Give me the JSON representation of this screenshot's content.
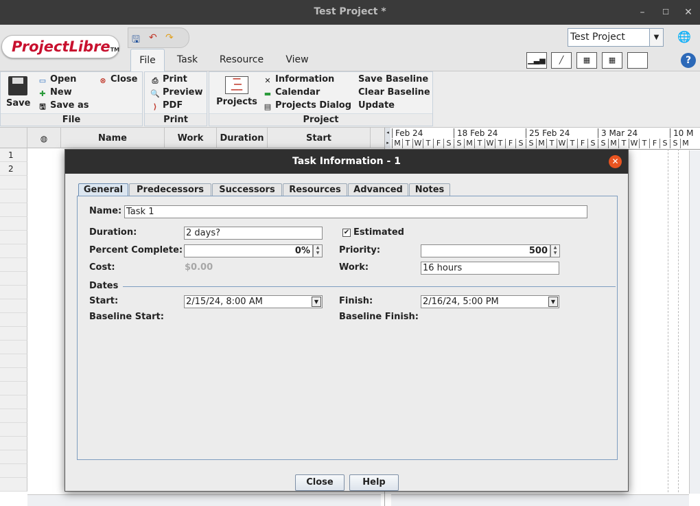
{
  "window": {
    "title": "Test Project *"
  },
  "logo": {
    "part1": "Project",
    "part2": "Libre",
    "tm": "TM"
  },
  "menu_tabs": [
    "File",
    "Task",
    "Resource",
    "View"
  ],
  "project_selector": {
    "value": "Test Project"
  },
  "ribbon": {
    "file_group": {
      "title": "File",
      "save": "Save",
      "open": "Open",
      "new": "New",
      "save_as": "Save as",
      "close": "Close"
    },
    "print_group": {
      "title": "Print",
      "print": "Print",
      "preview": "Preview",
      "pdf": "PDF"
    },
    "project_group": {
      "title": "Project",
      "projects": "Projects",
      "information": "Information",
      "calendar": "Calendar",
      "projects_dialog": "Projects Dialog",
      "save_baseline": "Save Baseline",
      "clear_baseline": "Clear Baseline",
      "update": "Update"
    }
  },
  "table": {
    "columns": [
      "Name",
      "Work",
      "Duration",
      "Start"
    ],
    "rows": [
      "1",
      "2"
    ]
  },
  "gantt": {
    "weeks": [
      "Feb 24",
      "18 Feb 24",
      "25 Feb 24",
      "3 Mar 24",
      "10 M"
    ],
    "days": [
      "M",
      "T",
      "W",
      "T",
      "F",
      "S",
      "S",
      "M",
      "T",
      "W",
      "T",
      "F",
      "S",
      "S",
      "M",
      "T",
      "W",
      "T",
      "F",
      "S",
      "S",
      "M",
      "T",
      "W",
      "T",
      "F",
      "S",
      "S",
      "M"
    ]
  },
  "dialog": {
    "title": "Task Information - 1",
    "tabs": [
      "General",
      "Predecessors",
      "Successors",
      "Resources",
      "Advanced",
      "Notes"
    ],
    "name_label": "Name:",
    "name_value": "Task 1",
    "duration_label": "Duration:",
    "duration_value": "2 days?",
    "estimated_label": "Estimated",
    "percent_label": "Percent Complete:",
    "percent_value": "0%",
    "priority_label": "Priority:",
    "priority_value": "500",
    "cost_label": "Cost:",
    "cost_value": "$0.00",
    "work_label": "Work:",
    "work_value": "16 hours",
    "dates_label": "Dates",
    "start_label": "Start:",
    "start_value": "2/15/24, 8:00 AM",
    "finish_label": "Finish:",
    "finish_value": "2/16/24, 5:00 PM",
    "baseline_start_label": "Baseline Start:",
    "baseline_finish_label": "Baseline Finish:",
    "close_button": "Close",
    "help_button": "Help"
  }
}
